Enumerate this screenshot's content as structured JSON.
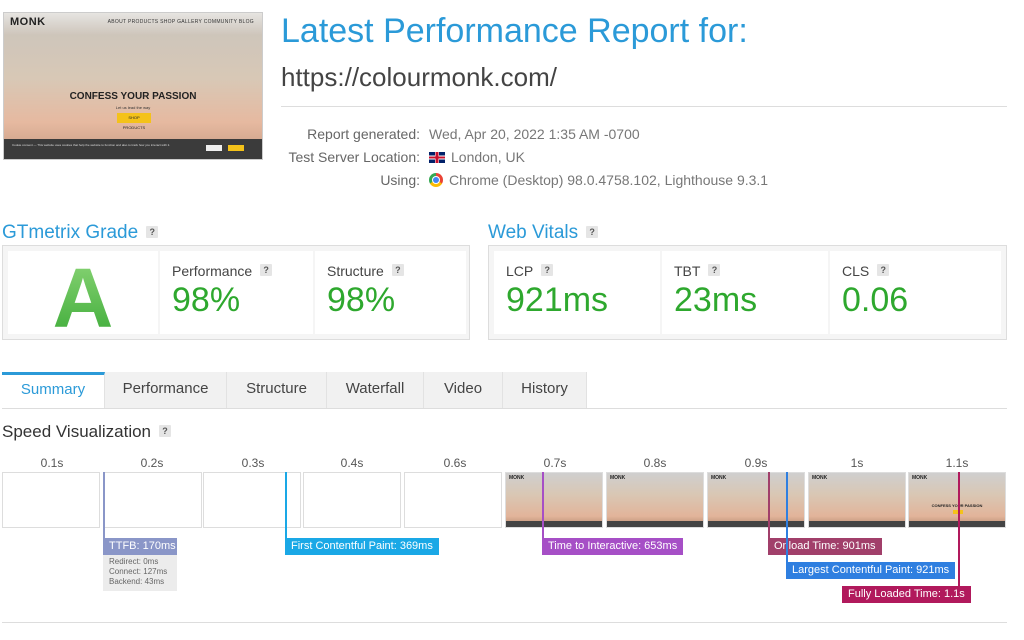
{
  "thumbnail": {
    "logo": "MONK",
    "menu": "ABOUT  PRODUCTS  SHOP  GALLERY  COMMUNITY  BLOG",
    "headline": "CONFESS YOUR PASSION",
    "subline": "Let us lead the way",
    "cta": "SHOP PRODUCTS",
    "cookie_text": "Cookie consent — This website uses cookies that help the website to function and also to track how you interact with it."
  },
  "report": {
    "title": "Latest Performance Report for:",
    "url": "https://colourmonk.com/",
    "meta": [
      {
        "label": "Report generated:",
        "value": "Wed, Apr 20, 2022 1:35 AM -0700",
        "icon": ""
      },
      {
        "label": "Test Server Location:",
        "value": "London, UK",
        "icon": "uk-flag-icon"
      },
      {
        "label": "Using:",
        "value": "Chrome (Desktop) 98.0.4758.102, Lighthouse 9.3.1",
        "icon": "chrome-icon"
      }
    ]
  },
  "grade": {
    "heading": "GTmetrix Grade",
    "help": "?",
    "letter": "A",
    "performance_label": "Performance",
    "performance_value": "98%",
    "structure_label": "Structure",
    "structure_value": "98%"
  },
  "vitals": {
    "heading": "Web Vitals",
    "help": "?",
    "items": [
      {
        "label": "LCP",
        "value": "921ms"
      },
      {
        "label": "TBT",
        "value": "23ms"
      },
      {
        "label": "CLS",
        "value": "0.06"
      }
    ]
  },
  "tabs": [
    "Summary",
    "Performance",
    "Structure",
    "Waterfall",
    "Video",
    "History"
  ],
  "active_tab": "Summary",
  "speed": {
    "heading": "Speed Visualization",
    "help": "?",
    "ticks": [
      "0.1s",
      "0.2s",
      "0.3s",
      "0.4s",
      "0.6s",
      "0.7s",
      "0.8s",
      "0.9s",
      "1s",
      "1.1s"
    ],
    "frames_loaded_from": 5,
    "markers": [
      {
        "label": "TTFB: 170ms",
        "color": "#8a96c8"
      },
      {
        "label": "First Contentful Paint: 369ms",
        "color": "#1aa8e6"
      },
      {
        "label": "Time to Interactive: 653ms",
        "color": "#a64fc6"
      },
      {
        "label": "Onload Time: 901ms",
        "color": "#a13f6a"
      },
      {
        "label": "Largest Contentful Paint: 921ms",
        "color": "#2f7fe0"
      },
      {
        "label": "Fully Loaded Time: 1.1s",
        "color": "#b1195c"
      }
    ],
    "ttfb_breakdown": [
      "Redirect: 0ms",
      "Connect: 127ms",
      "Backend: 43ms"
    ]
  },
  "colors": {
    "accent": "#2b9ad8",
    "good": "#2ea82e"
  }
}
